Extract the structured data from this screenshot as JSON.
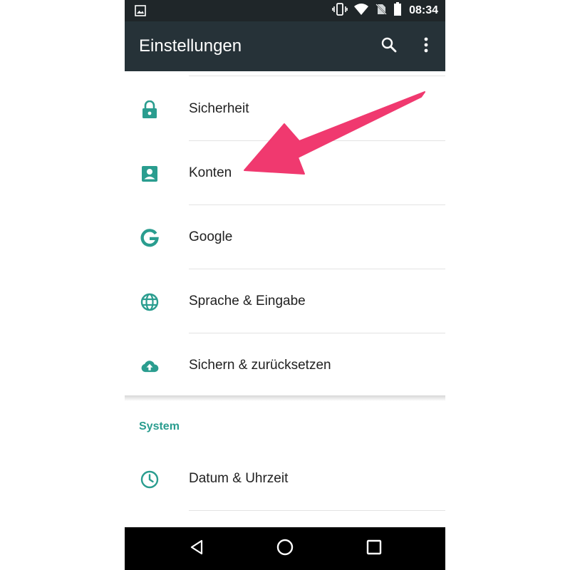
{
  "status_bar": {
    "time": "08:34",
    "icons": [
      "image-icon",
      "vibrate-icon",
      "wifi-icon",
      "no-sim-icon",
      "battery-icon"
    ]
  },
  "app_bar": {
    "title": "Einstellungen",
    "icons": [
      "search-icon",
      "more-vert-icon"
    ]
  },
  "settings": {
    "items": [
      {
        "label": "Sicherheit",
        "icon": "lock-icon"
      },
      {
        "label": "Konten",
        "icon": "account-box-icon"
      },
      {
        "label": "Google",
        "icon": "google-g-icon"
      },
      {
        "label": "Sprache & Eingabe",
        "icon": "globe-icon"
      },
      {
        "label": "Sichern & zurücksetzen",
        "icon": "cloud-upload-icon"
      }
    ],
    "system_header": "System",
    "system_items": [
      {
        "label": "Datum & Uhrzeit",
        "icon": "clock-icon"
      }
    ]
  },
  "annotation": {
    "arrow_color": "#f0396f",
    "target": "Konten"
  },
  "nav_bar": {
    "icons": [
      "back-icon",
      "home-icon",
      "recents-icon"
    ]
  },
  "colors": {
    "accent": "#2a9d8f",
    "app_bar": "#263238",
    "status_bar": "#1f2629"
  }
}
